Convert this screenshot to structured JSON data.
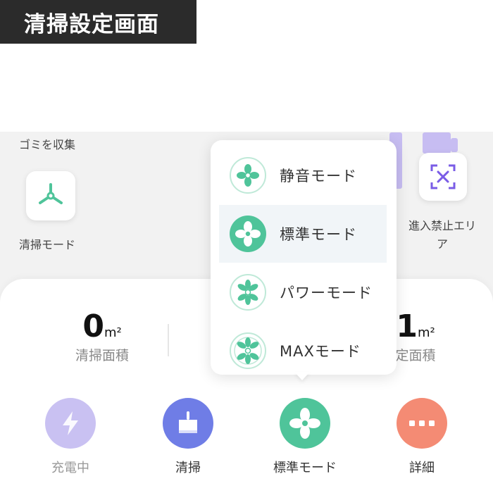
{
  "header": {
    "title": "清掃設定画面"
  },
  "map": {
    "hint": "ゴミを収集",
    "tools": {
      "clean_mode_label": "清掃モード",
      "no_go_label_line1": "進入禁止エリ",
      "no_go_label_line2": "ア"
    }
  },
  "stats": {
    "left": {
      "value": "0",
      "unit": "m²",
      "label": "清掃面積"
    },
    "right": {
      "value": "1",
      "unit": "m²",
      "label": "定面積"
    }
  },
  "suction_menu": {
    "items": [
      {
        "label": "静音モード",
        "icon": "fan-quiet-icon",
        "selected": false
      },
      {
        "label": "標準モード",
        "icon": "fan-standard-icon",
        "selected": true
      },
      {
        "label": "パワーモード",
        "icon": "fan-power-icon",
        "selected": false
      },
      {
        "label": "MAXモード",
        "icon": "fan-max-icon",
        "selected": false
      }
    ]
  },
  "actions": [
    {
      "label": "充電中",
      "icon": "lightning-icon",
      "color": "#c9c1f2",
      "label_color": "#999999"
    },
    {
      "label": "清掃",
      "icon": "broom-icon",
      "color": "#6f7de6",
      "label_color": "#333333"
    },
    {
      "label": "標準モード",
      "icon": "fan-icon",
      "color": "#4fc49a",
      "label_color": "#333333"
    },
    {
      "label": "詳細",
      "icon": "more-icon",
      "color": "#f48b74",
      "label_color": "#333333"
    }
  ],
  "colors": {
    "accent_green": "#4fc49a",
    "no_go_purple": "#7a5ce6"
  }
}
